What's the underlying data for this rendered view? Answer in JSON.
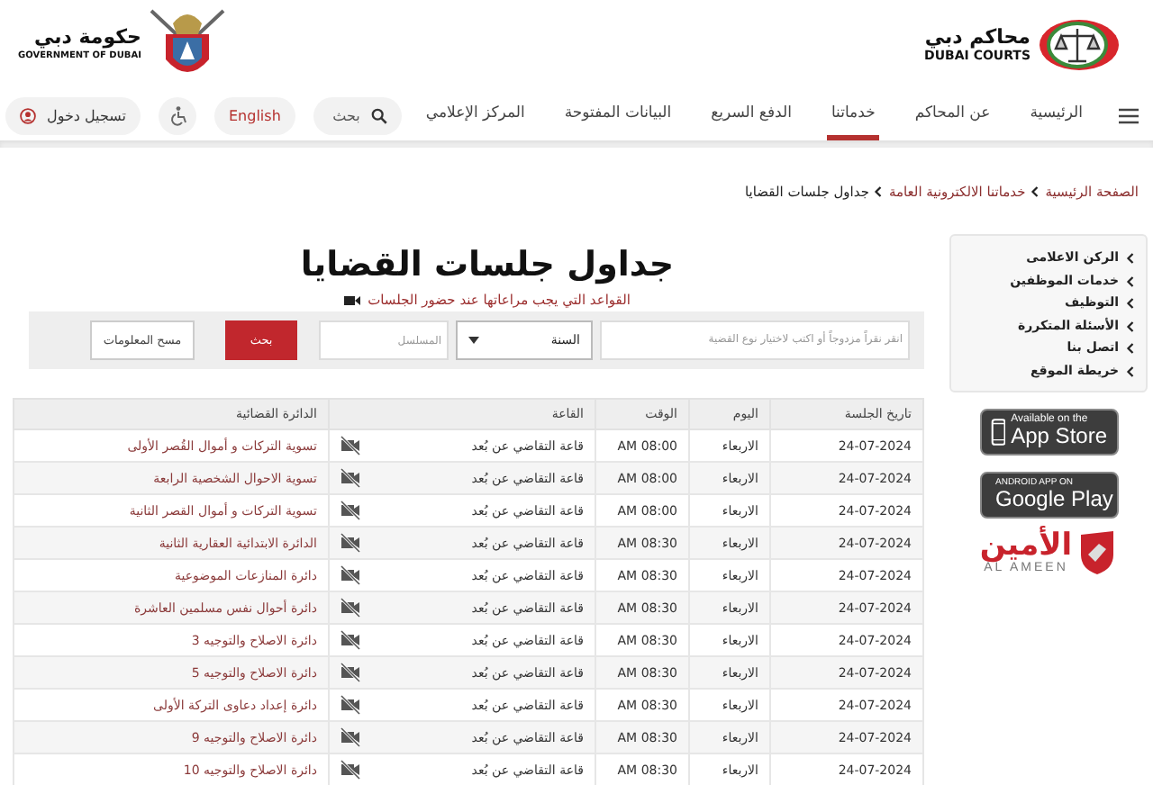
{
  "header": {
    "courts_logo": {
      "arabic": "محاكم دبي",
      "english": "DUBAI COURTS"
    },
    "government_logo": {
      "arabic": "حكومة دبي",
      "english": "GOVERNMENT OF DUBAI"
    }
  },
  "nav": {
    "items": [
      {
        "label": "الرئيسية",
        "selected": false
      },
      {
        "label": "عن المحاكم",
        "selected": false
      },
      {
        "label": "خدماتنا",
        "selected": true
      },
      {
        "label": "الدفع السريع",
        "selected": false
      },
      {
        "label": "البيانات المفتوحة",
        "selected": false
      },
      {
        "label": "المركز الإعلامي",
        "selected": false
      }
    ],
    "search": {
      "placeholder": "بحث"
    },
    "language": "English",
    "login": "تسجيل دخول"
  },
  "breadcrumb": [
    {
      "label": "الصفحة الرئيسية",
      "kind": "link"
    },
    {
      "label": "خدماتنا الالكترونية العامة",
      "kind": "link"
    },
    {
      "label": "جداول جلسات القضايا",
      "kind": "current"
    }
  ],
  "sidebar": {
    "items": [
      "الركن الاعلامى",
      "خدمات الموظفين",
      "التوظيف",
      "الأسئلة المتكررة",
      "اتصل بنا",
      "خريطة الموقع"
    ]
  },
  "apps": [
    {
      "kind": "apple",
      "small": "Available on the",
      "big": "App Store"
    },
    {
      "kind": "android",
      "small": "ANDROID APP ON",
      "big": "Google Play"
    }
  ],
  "partner": {
    "arabic": "الأمين",
    "english": "AL AMEEN"
  },
  "page_title": "جداول جلسات القضايا",
  "rules_link": "القواعد التي يجب مراعاتها عند حضور الجلسات",
  "search_form": {
    "case_type": {
      "placeholder": "انقر نقراً مزدوجاً أو اكتب لاختيار نوع القضية"
    },
    "year": {
      "value": "السنة"
    },
    "serial": {
      "placeholder": "المسلسل"
    },
    "search_button": "بحث",
    "clear_button": "مسح المعلومات"
  },
  "table": {
    "columns": [
      "تاريخ الجلسة",
      "اليوم",
      "الوقت",
      "القاعة",
      "الدائرة القضائية"
    ],
    "rows": [
      {
        "date": "24-07-2024",
        "day": "الاربعاء",
        "time": "08:00 AM",
        "hall": "قاعة التقاضي عن بُعد",
        "circuit": "تسوية التركات و أموال القُصر الأولى"
      },
      {
        "date": "24-07-2024",
        "day": "الاربعاء",
        "time": "08:00 AM",
        "hall": "قاعة التقاضي عن بُعد",
        "circuit": "تسوية الاحوال الشخصية الرابعة"
      },
      {
        "date": "24-07-2024",
        "day": "الاربعاء",
        "time": "08:00 AM",
        "hall": "قاعة التقاضي عن بُعد",
        "circuit": "تسوية التركات و أموال القصر الثانية"
      },
      {
        "date": "24-07-2024",
        "day": "الاربعاء",
        "time": "08:30 AM",
        "hall": "قاعة التقاضي عن بُعد",
        "circuit": "الدائرة الابتدائية العقارية الثانية"
      },
      {
        "date": "24-07-2024",
        "day": "الاربعاء",
        "time": "08:30 AM",
        "hall": "قاعة التقاضي عن بُعد",
        "circuit": "دائرة المنازعات الموضوعية"
      },
      {
        "date": "24-07-2024",
        "day": "الاربعاء",
        "time": "08:30 AM",
        "hall": "قاعة التقاضي عن بُعد",
        "circuit": "دائرة أحوال نفس مسلمين العاشرة"
      },
      {
        "date": "24-07-2024",
        "day": "الاربعاء",
        "time": "08:30 AM",
        "hall": "قاعة التقاضي عن بُعد",
        "circuit": "دائرة الاصلاح والتوجيه 3"
      },
      {
        "date": "24-07-2024",
        "day": "الاربعاء",
        "time": "08:30 AM",
        "hall": "قاعة التقاضي عن بُعد",
        "circuit": "دائرة الاصلاح والتوجيه 5"
      },
      {
        "date": "24-07-2024",
        "day": "الاربعاء",
        "time": "08:30 AM",
        "hall": "قاعة التقاضي عن بُعد",
        "circuit": "دائرة إعداد دعاوى التركة الأولى"
      },
      {
        "date": "24-07-2024",
        "day": "الاربعاء",
        "time": "08:30 AM",
        "hall": "قاعة التقاضي عن بُعد",
        "circuit": "دائرة الاصلاح والتوجيه 9"
      },
      {
        "date": "24-07-2024",
        "day": "الاربعاء",
        "time": "08:30 AM",
        "hall": "قاعة التقاضي عن بُعد",
        "circuit": "دائرة الاصلاح والتوجيه 10"
      }
    ]
  }
}
